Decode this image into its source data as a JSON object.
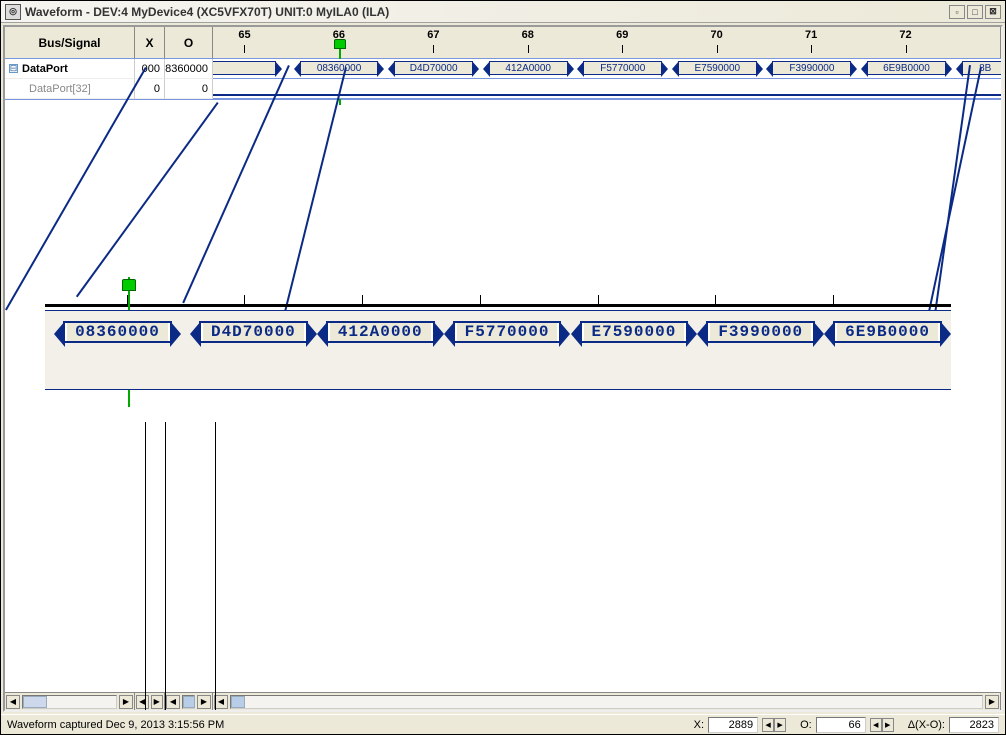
{
  "title": "Waveform - DEV:4 MyDevice4 (XC5VFX70T) UNIT:0 MyILA0 (ILA)",
  "headers": {
    "signal": "Bus/Signal",
    "x": "X",
    "o": "O"
  },
  "ruler_ticks": [
    "65",
    "66",
    "67",
    "68",
    "69",
    "70",
    "71",
    "72"
  ],
  "signals": {
    "dataport": {
      "label": "DataPort",
      "x": "000",
      "o": "08360000"
    },
    "dataport32": {
      "label": "DataPort[32]",
      "x": "0",
      "o": "0"
    }
  },
  "wave_vals": [
    "08360000",
    "D4D70000",
    "412A0000",
    "F5770000",
    "E7590000",
    "F3990000",
    "6E9B0000",
    "8B"
  ],
  "zoom_vals": [
    "08360000",
    "D4D70000",
    "412A0000",
    "F5770000",
    "E7590000",
    "F3990000",
    "6E9B0000"
  ],
  "status": {
    "captured": "Waveform captured Dec 9, 2013 3:15:56 PM",
    "x_label": "X:",
    "x_val": "2889",
    "o_label": "O:",
    "o_val": "66",
    "d_label": "Δ(X-O):",
    "d_val": "2823"
  },
  "colors": {
    "bus": "#0b2a85",
    "cursor": "#00aa00",
    "bg": "#ece9d8"
  }
}
